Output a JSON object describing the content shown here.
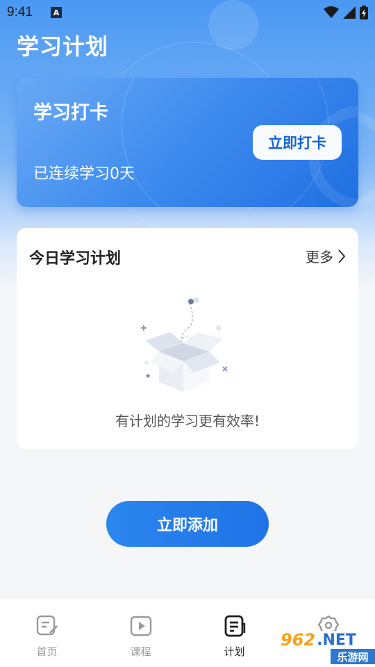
{
  "status_bar": {
    "time": "9:41",
    "notification_icon": "a-badge-icon",
    "wifi_icon": "wifi-icon",
    "signal_icon": "signal-icon",
    "battery_icon": "battery-icon"
  },
  "header": {
    "title": "学习计划"
  },
  "checkin_card": {
    "title": "学习打卡",
    "streak_text": "已连续学习0天",
    "button_label": "立即打卡"
  },
  "plan_card": {
    "title": "今日学习计划",
    "more_label": "更多",
    "empty_text": "有计划的学习更有效率!",
    "illustration": "open-empty-box"
  },
  "add_button": {
    "label": "立即添加"
  },
  "tabbar": {
    "items": [
      {
        "label": "首页",
        "icon": "home-note-icon",
        "active": false
      },
      {
        "label": "课程",
        "icon": "play-video-icon",
        "active": false
      },
      {
        "label": "计划",
        "icon": "plan-document-icon",
        "active": true
      },
      {
        "label": "",
        "icon": "settings-gear-icon",
        "active": false
      }
    ]
  },
  "watermark": {
    "number": "962",
    "suffix": ".NET",
    "site": "乐游网"
  },
  "colors": {
    "primary": "#1f73e6",
    "header_gradient_top": "#4a98f3",
    "page_background": "#f5f6f8",
    "card_background": "#ffffff"
  }
}
